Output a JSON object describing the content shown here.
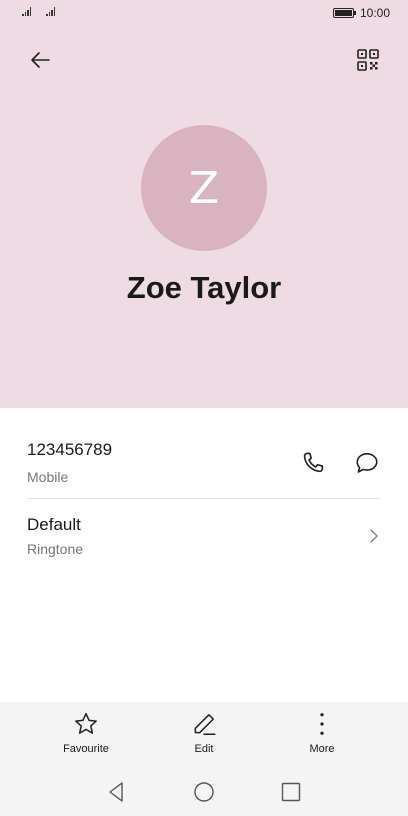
{
  "status_bar": {
    "time": "10:00"
  },
  "contact": {
    "initial": "Z",
    "name": "Zoe Taylor",
    "avatar_color": "#d9b4c0",
    "header_color": "#efdbe3"
  },
  "phone": {
    "number": "123456789",
    "type": "Mobile"
  },
  "ringtone": {
    "value": "Default",
    "label": "Ringtone"
  },
  "toolbar": {
    "favourite_label": "Favourite",
    "edit_label": "Edit",
    "more_label": "More"
  },
  "icons": {
    "back": "back-arrow-icon",
    "qr": "qr-code-icon",
    "call": "phone-icon",
    "message": "message-bubble-icon",
    "chevron": "chevron-right-icon",
    "favourite": "star-icon",
    "edit": "pencil-icon",
    "more": "more-vertical-icon"
  }
}
